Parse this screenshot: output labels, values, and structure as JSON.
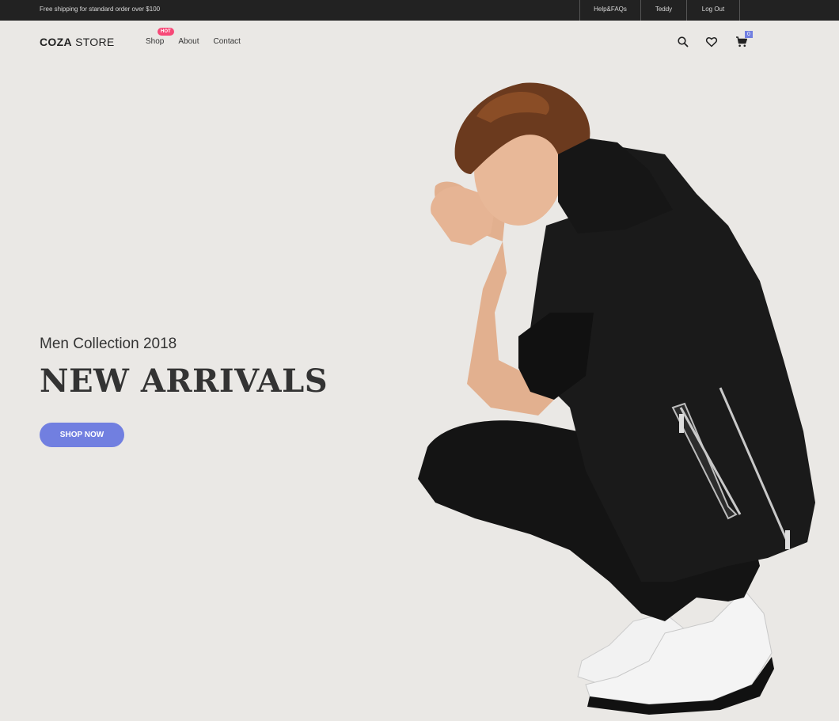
{
  "topbar": {
    "shipping": "Free shipping for standard order over $100",
    "links": [
      "Help&FAQs",
      "Teddy",
      "Log Out"
    ]
  },
  "header": {
    "logo_bold": "COZA",
    "logo_rest": " STORE",
    "nav": [
      "Shop",
      "About",
      "Contact"
    ],
    "hot_badge": "HOT",
    "cart_count": "0",
    "icons": [
      "search-icon",
      "heart-icon",
      "cart-icon"
    ]
  },
  "hero": {
    "subtitle": "Men Collection 2018",
    "title": "NEW ARRIVALS",
    "button": "SHOP NOW"
  },
  "colors": {
    "accent": "#717fe0",
    "hot": "#f74877",
    "topbar": "#222222",
    "background": "#eae8e5"
  }
}
